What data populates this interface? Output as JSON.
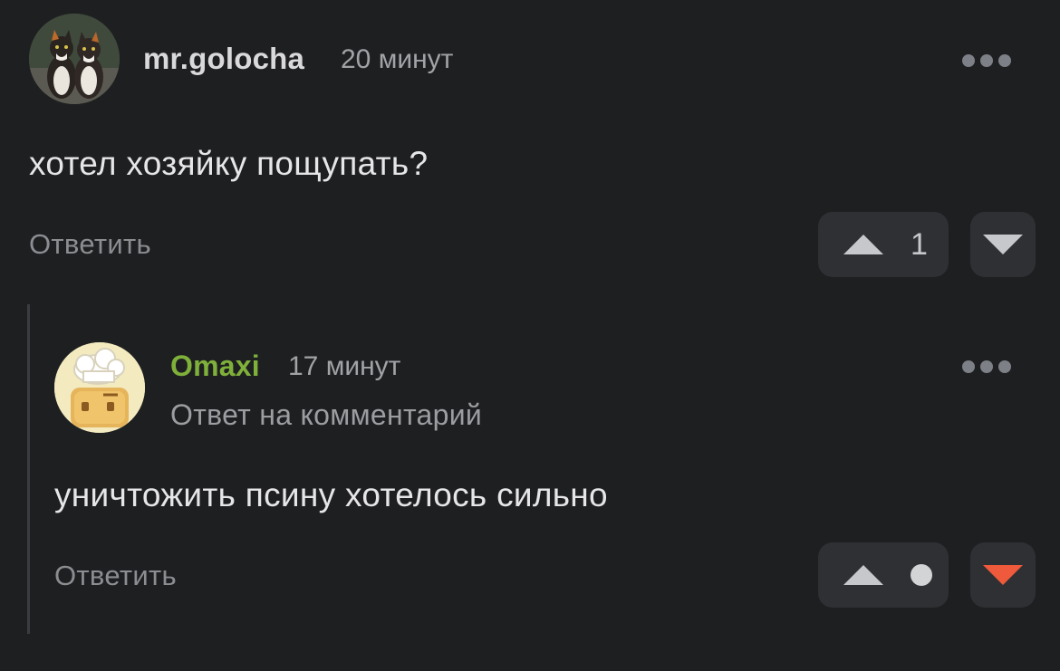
{
  "comments": [
    {
      "author": "mr.golocha",
      "time": "20 минут",
      "text": "хотел хозяйку пощупать?",
      "reply_label": "Ответить",
      "score": "1",
      "downvoted": false
    },
    {
      "author": "Omaxi",
      "time": "17 минут",
      "reply_note": "Ответ на комментарий",
      "text": "уничтожить псину хотелось сильно",
      "reply_label": "Ответить",
      "score_state": "hidden",
      "downvoted": true,
      "author_color": "#7fb03a",
      "downvote_color": "#ee5a3b"
    }
  ]
}
